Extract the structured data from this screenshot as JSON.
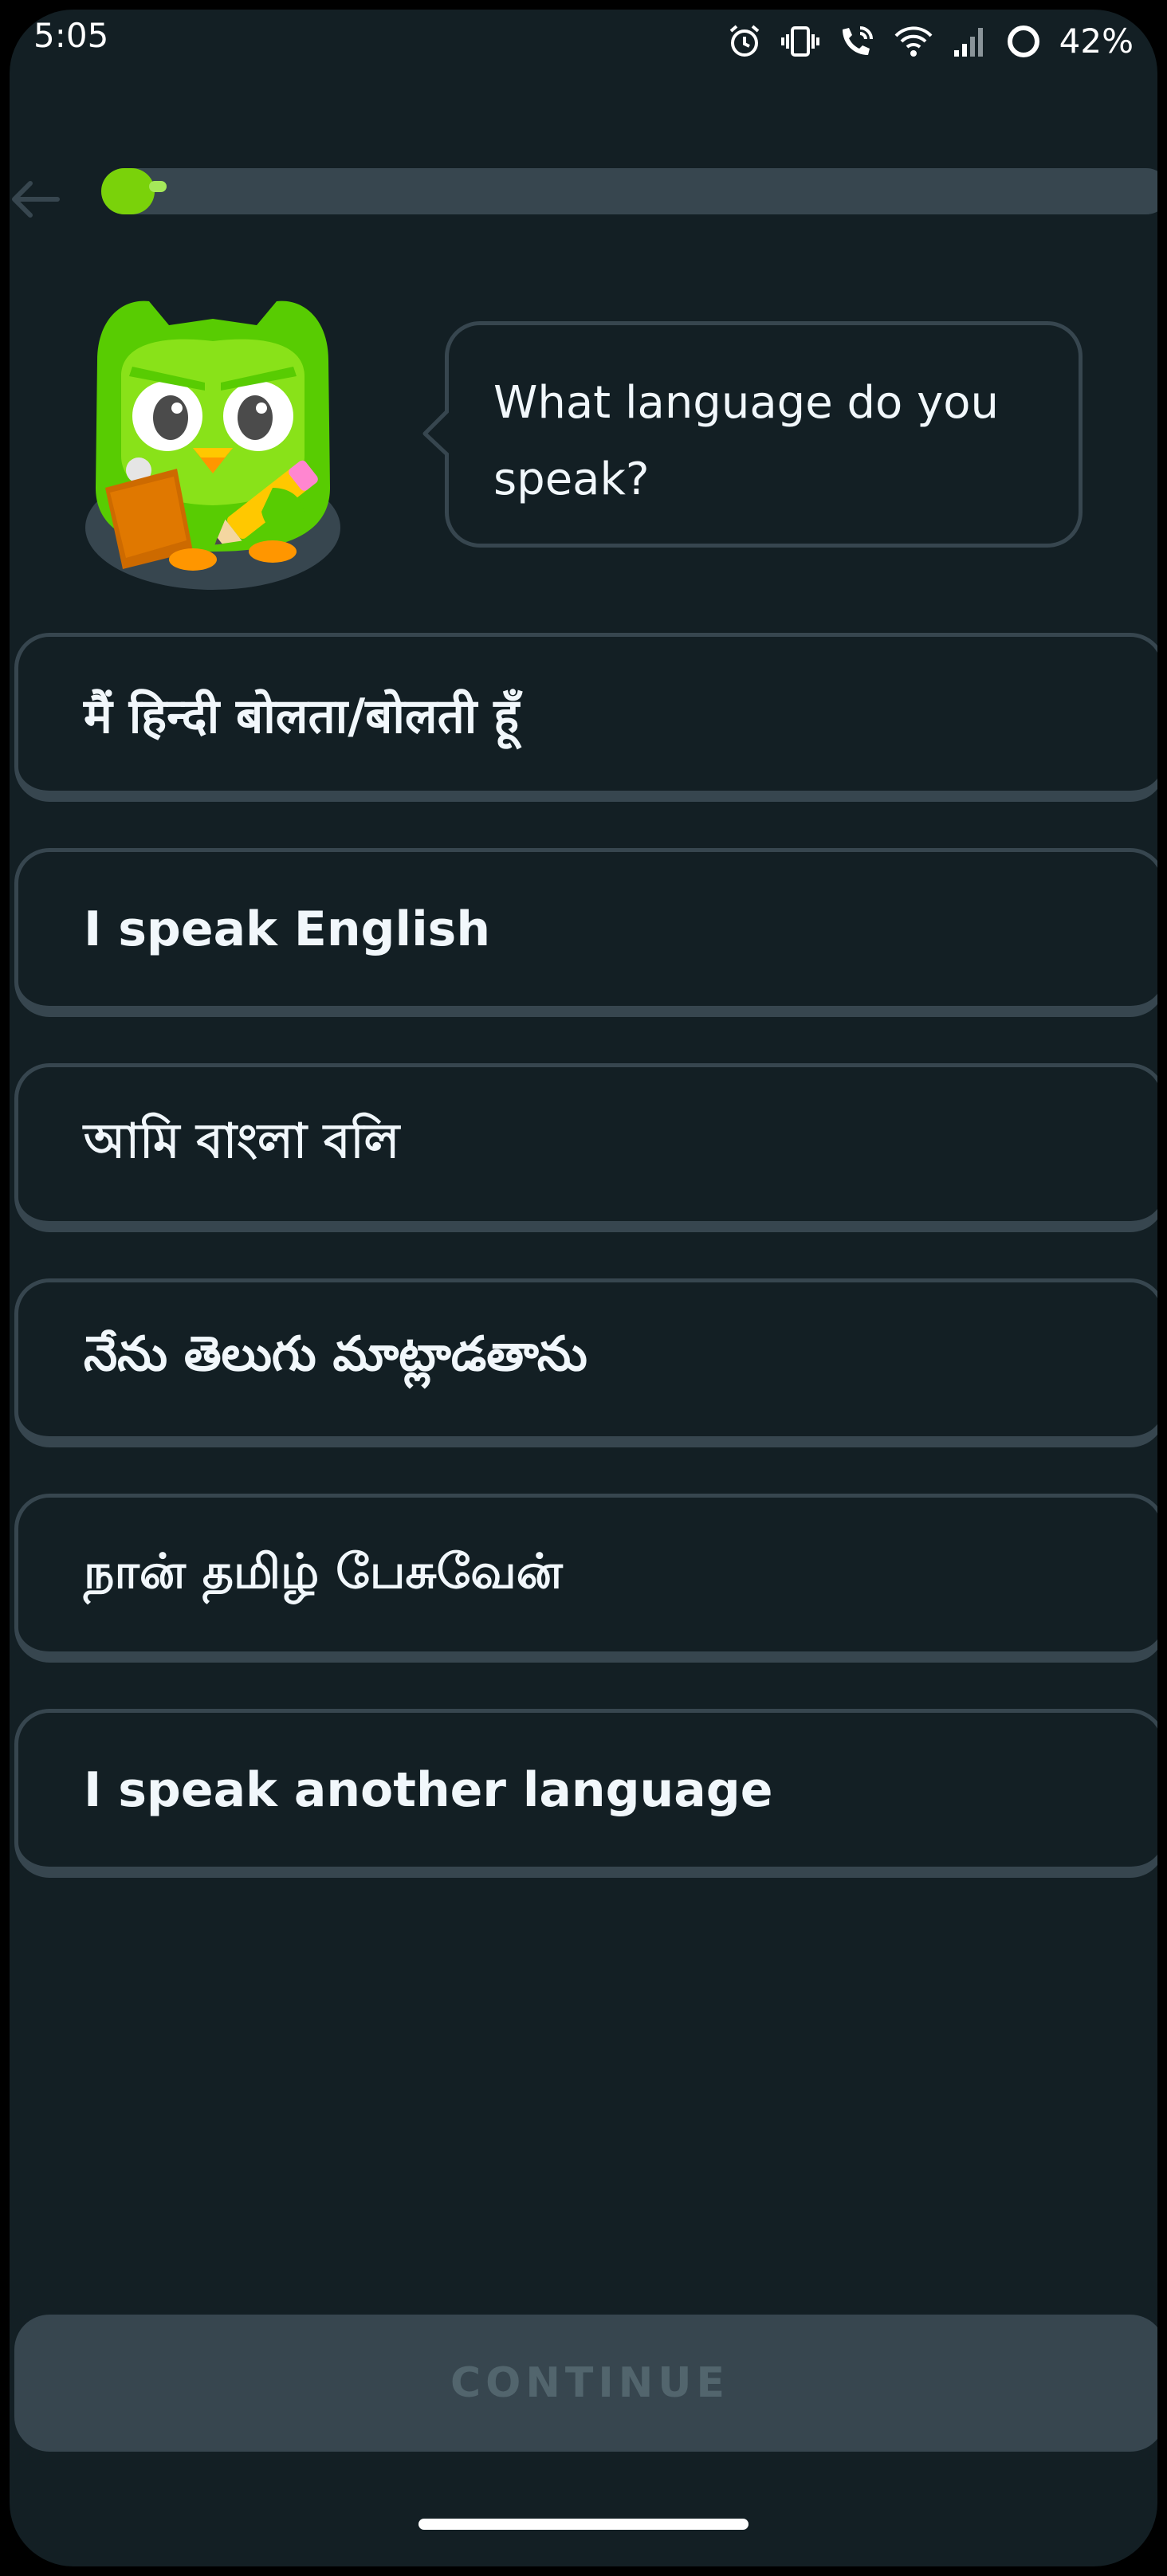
{
  "status_bar": {
    "time": "5:05",
    "battery_percent": "42%",
    "icons": [
      "alarm-icon",
      "vibrate-icon",
      "wifi-calling-icon",
      "wifi-icon",
      "signal-icon",
      "battery-icon"
    ]
  },
  "header": {
    "back_icon": "arrow-left-icon",
    "progress_fraction": 0.05,
    "accent_color": "#7ad20a"
  },
  "prompt": {
    "question": "What language do you speak?",
    "mascot_icon": "owl-mascot-icon"
  },
  "options": [
    {
      "label": "मैं हिन्दी बोलता/बोलती हूँ"
    },
    {
      "label": "I speak English"
    },
    {
      "label": "আমি বাংলা বলি"
    },
    {
      "label": "నేను తెలుగు మాట్లాడతాను"
    },
    {
      "label": "நான் தமிழ் பேசுவேன்"
    },
    {
      "label": "I speak another language"
    }
  ],
  "footer": {
    "continue_label": "CONTINUE"
  },
  "colors": {
    "background": "#131f24",
    "border": "#37464f",
    "text": "#f1f7fb",
    "disabled_text": "#52656d"
  }
}
